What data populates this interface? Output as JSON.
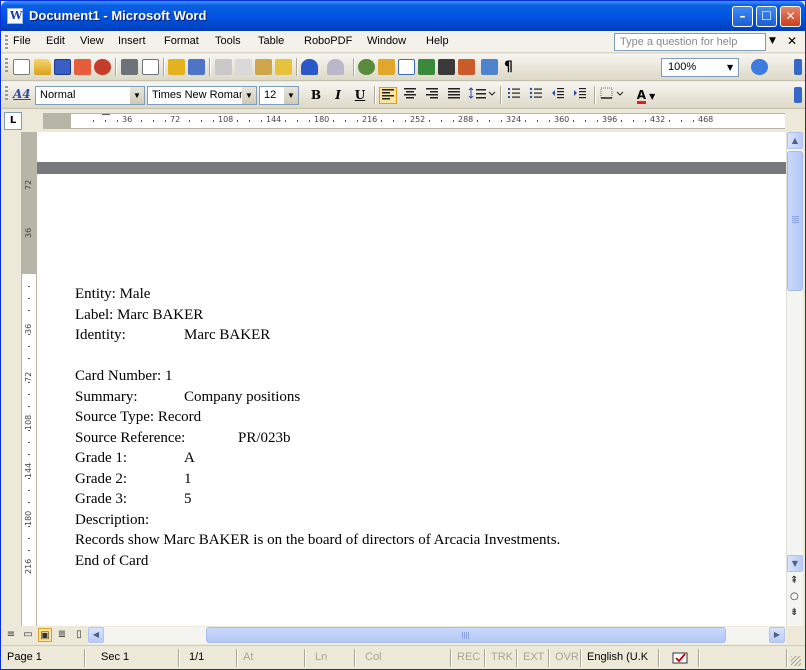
{
  "window": {
    "title": "Document1 - Microsoft Word",
    "minimize_glyph": "–",
    "maximize_glyph": "☐",
    "close_glyph": "✕"
  },
  "menubar": {
    "items": [
      "File",
      "Edit",
      "View",
      "Insert",
      "Format",
      "Tools",
      "Table",
      "RoboPDF",
      "Window",
      "Help"
    ],
    "ask_placeholder": "Type a question for help",
    "close_doc_glyph": "✕"
  },
  "standard_toolbar": {
    "zoom": "100%",
    "pilcrow": "¶"
  },
  "formatting_toolbar": {
    "style": "Normal",
    "style_icon": "A4",
    "font": "Times New Roman",
    "size": "12",
    "bold": "B",
    "italic": "I",
    "underline": "U",
    "font_color_glyph": "A"
  },
  "ruler": {
    "tab_selector": "L",
    "h_ticks": [
      "36",
      "72",
      "108",
      "144",
      "180",
      "216",
      "252",
      "288",
      "324",
      "360",
      "396",
      "432",
      "468"
    ],
    "v_ticks_top": [
      "72",
      "36"
    ],
    "v_ticks_body": [
      "36",
      "72",
      "108",
      "144",
      "180",
      "216"
    ]
  },
  "document": {
    "lines": [
      {
        "parts": [
          "Entity: Male"
        ]
      },
      {
        "parts": [
          "Label:  Marc BAKER"
        ]
      },
      {
        "parts": [
          "Identity:",
          "Marc BAKER"
        ]
      },
      {
        "parts": [
          ""
        ]
      },
      {
        "parts": [
          "Card Number: 1"
        ]
      },
      {
        "parts": [
          "Summary:",
          "Company positions"
        ]
      },
      {
        "parts": [
          "Source Type:  Record"
        ]
      },
      {
        "parts": [
          "Source Reference:",
          "PR/023b"
        ]
      },
      {
        "parts": [
          "Grade 1:",
          "A"
        ]
      },
      {
        "parts": [
          "Grade 2:",
          "1"
        ]
      },
      {
        "parts": [
          "Grade 3:",
          "5"
        ]
      },
      {
        "parts": [
          "Description:"
        ]
      },
      {
        "parts": [
          "Records show Marc BAKER is on the board of directors of Arcacia Investments."
        ]
      },
      {
        "parts": [
          "End of Card"
        ]
      }
    ]
  },
  "statusbar": {
    "page": "Page  1",
    "sec": "Sec  1",
    "pages": "1/1",
    "at": "At",
    "ln": "Ln",
    "col": "Col",
    "rec": "REC",
    "trk": "TRK",
    "ext": "EXT",
    "ovr": "OVR",
    "language": "English (U.K"
  },
  "colors": {
    "titlebar": "#0054e3",
    "active_button": "#fce49c"
  }
}
